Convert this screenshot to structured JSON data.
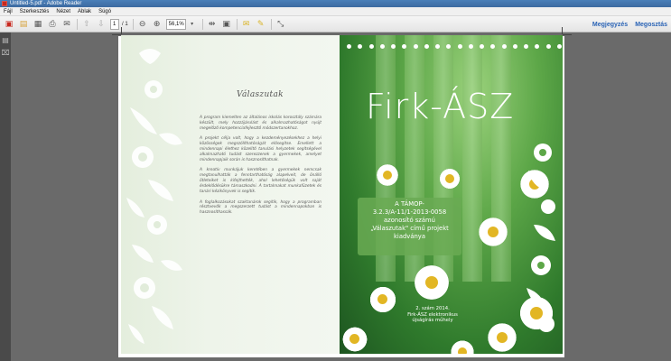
{
  "window": {
    "title": "Untitled-5.pdf - Adobe Reader"
  },
  "menu": [
    "Fájl",
    "Szerkesztés",
    "Nézet",
    "Ablak",
    "Súgó"
  ],
  "toolbar": {
    "page_current": "1",
    "page_total": "/ 1",
    "zoom": "56,1%",
    "links": [
      "Megjegyzés",
      "Megosztás"
    ]
  },
  "left_page": {
    "heading": "Válaszutak",
    "paragraphs": [
      "A program kiemelten az általános iskolás korosztály számára készült, mely hozzájárulást és alkalmazhatóságot nyújt megelőző kompetenciafejlesztő módszertanokhoz.",
      "A projekt célja volt, hogy a kezdeményezésekhez a helyi közösségek megszólíthatóságát elősegítse. Emellett a mindennapi élethez közelítő tanulási helyzetek segítségével alkalmazható tudást szerezzenek a gyermekek, amelyet mindennapjaik során is hasznosíthatnak.",
      "A kreatív munkájuk keretében a gyermekek nemcsak megtanulhatták a fenntarthatóság alapelveit, de önálló ötleteiket is kifejthették, ahol lehetőségük volt saját érdeklődésükre támaszkodni. A tartalmakat munkafüzetek és tanári kézikönyvek is segítik.",
      "A foglalkozásokat szaktanárok segítik, hogy a programban résztvevők a megszerzett tudást a mindennapokban is hasznosíthassák."
    ]
  },
  "cover": {
    "title": "Firk-ÁSZ",
    "box_lines": [
      "A TÁMOP-",
      "3.2.3/A-11/1-2013-0058",
      "azonosító számú",
      "„Válaszutak\" című projekt",
      "kiadványa"
    ],
    "date_lines": [
      "2. szám 2014.",
      "Firk-ÁSZ elektronikus",
      "újságírás műhely"
    ]
  },
  "colors": {
    "accent_link": "#2a63b5",
    "cover_green": "#3f8f38",
    "titlebar": "#4a7fb8"
  }
}
